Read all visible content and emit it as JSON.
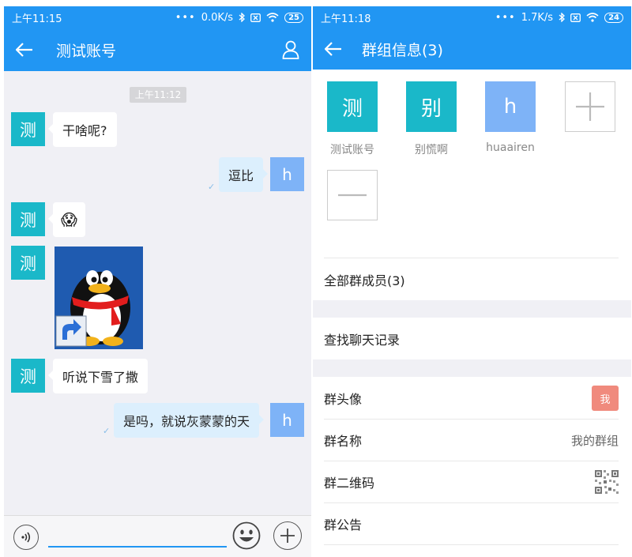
{
  "chat_screen": {
    "status": {
      "time": "上午11:15",
      "dots": "•••",
      "speed": "0.0K/s",
      "battery": "25"
    },
    "title": "测试账号",
    "timestamp": "上午11:12",
    "messages": [
      {
        "side": "in",
        "avatar": "测",
        "text": "干啥呢?"
      },
      {
        "side": "out",
        "avatar": "h",
        "text": "逗比"
      },
      {
        "side": "in",
        "avatar": "测",
        "emoji": "😱"
      },
      {
        "side": "in",
        "avatar": "测",
        "image": "qq-penguin-shortcut"
      },
      {
        "side": "in",
        "avatar": "测",
        "text": "听说下雪了撒"
      },
      {
        "side": "out",
        "avatar": "h",
        "text": "是吗，就说灰蒙蒙的天"
      }
    ]
  },
  "group_screen": {
    "status": {
      "time": "上午11:18",
      "dots": "•••",
      "speed": "1.7K/s",
      "battery": "24"
    },
    "title": "群组信息(3)",
    "members": [
      {
        "avatar": "测",
        "name": "测试账号",
        "color": "#1ab8c9"
      },
      {
        "avatar": "别",
        "name": "别慌啊",
        "color": "#1ab8c9"
      },
      {
        "avatar": "h",
        "name": "huaairen",
        "color": "#7eb3f7"
      }
    ],
    "all_members_label": "全部群成员(3)",
    "search_history_label": "查找聊天记录",
    "group_avatar_label": "群头像",
    "group_avatar_badge": "我",
    "group_name_label": "群名称",
    "group_name_value": "我的群组",
    "qr_label": "群二维码",
    "announcement_label": "群公告"
  },
  "colors": {
    "primary": "#2196f3",
    "avatar_cyan": "#1ab8c9",
    "avatar_blue": "#7eb3f7",
    "bubble_out": "#dceffd",
    "badge": "#f08a7d"
  }
}
